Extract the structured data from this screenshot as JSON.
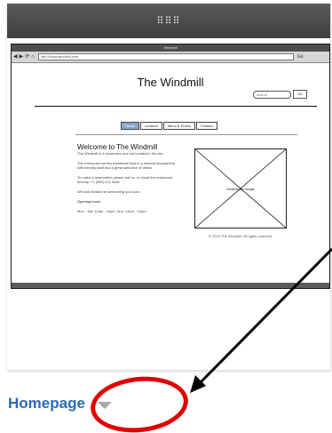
{
  "drag_handle": {
    "glyph": "⠿⠿⠿"
  },
  "thumbnail": {
    "browser_title": "Windmill",
    "address": "http://www.windmill.com",
    "nav_back": "◀",
    "nav_forward": "▶",
    "nav_reload": "⟳",
    "nav_home": "⌂",
    "go": "Go",
    "site": {
      "title": "The Windmill",
      "search_placeholder": "search",
      "search_button": "Go",
      "nav_items": [
        "Home",
        "Location",
        "Menu & Prices",
        "Contact"
      ],
      "welcome_heading": "Welcome to The Windmill",
      "tagline": "The Windmill is a restaurant and bar located in the city.",
      "para_1": "The restaurant serves traditional food in a relaxed atmosphere with friendly staff and a great selection of drinks.",
      "para_2": "To make a reservation please call us, or email the restaurant directly: +1 (555) 012 3456",
      "para_3": "We look forward to welcoming you soon.",
      "opening_heading": "Opening hours",
      "opening_hours": "Mon - Sat: 11am - 11pm, Sun: 12pm - 10pm",
      "image_label": "Restaurant image",
      "caption": "© 2013 The Windmill. All rights reserved."
    }
  },
  "page_label": "Homepage",
  "colors": {
    "label_blue": "#2a6ab8",
    "annotation_red": "#e00000",
    "active_tab": "#8aa6cf"
  }
}
